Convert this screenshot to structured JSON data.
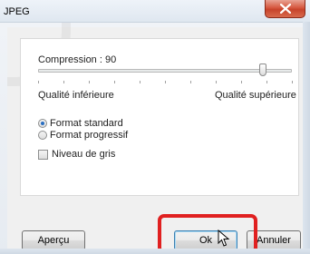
{
  "window": {
    "title": "JPEG"
  },
  "compression": {
    "label": "Compression : 90",
    "value": 90,
    "min": 0,
    "max": 100
  },
  "quality": {
    "low_label": "Qualité inférieure",
    "high_label": "Qualité supérieure"
  },
  "format_options": [
    {
      "label": "Format standard",
      "checked": true
    },
    {
      "label": "Format progressif",
      "checked": false
    }
  ],
  "grayscale": {
    "label": "Niveau de gris",
    "checked": false
  },
  "buttons": {
    "preview": "Aperçu",
    "ok": "Ok",
    "cancel": "Annuler"
  },
  "colors": {
    "highlight": "#e02020",
    "close_button": "#c7432b",
    "radio_accent": "#2a6fc2"
  }
}
